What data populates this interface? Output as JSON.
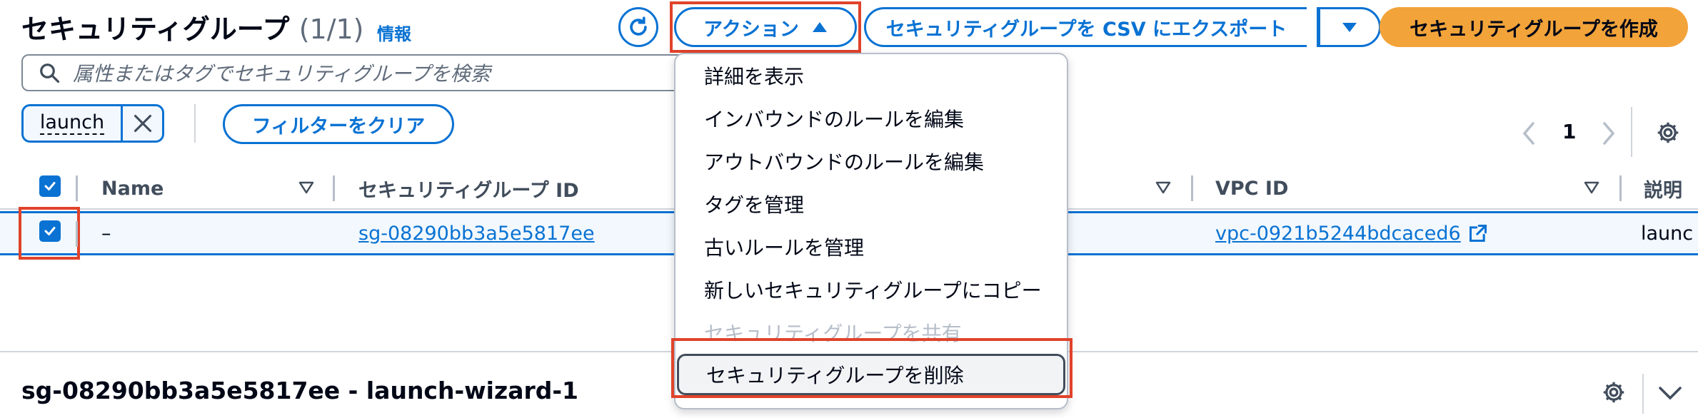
{
  "header": {
    "title": "セキュリティグループ",
    "count": "(1/1)",
    "info": "情報",
    "actions_label": "アクション",
    "export_label": "セキュリティグループを CSV にエクスポート",
    "create_label": "セキュリティグループを作成"
  },
  "search": {
    "placeholder": "属性またはタグでセキュリティグループを検索"
  },
  "filter": {
    "token": "launch",
    "clear_label": "フィルターをクリア"
  },
  "pagination": {
    "current_page": "1"
  },
  "table": {
    "columns": [
      "Name",
      "セキュリティグループ ID",
      "VPC ID",
      "説明"
    ],
    "rows": [
      {
        "name": "–",
        "sg_id": "sg-08290bb3a5e5817ee",
        "vpc_id": "vpc-0921b5244bdcaced6",
        "description": "launc"
      }
    ]
  },
  "actions_menu": {
    "items": [
      {
        "label": "詳細を表示",
        "disabled": false
      },
      {
        "label": "インバウンドのルールを編集",
        "disabled": false
      },
      {
        "label": "アウトバウンドのルールを編集",
        "disabled": false
      },
      {
        "label": "タグを管理",
        "disabled": false
      },
      {
        "label": "古いルールを管理",
        "disabled": false
      },
      {
        "label": "新しいセキュリティグループにコピー",
        "disabled": false
      },
      {
        "label": "セキュリティグループを共有",
        "disabled": true
      },
      {
        "label": "セキュリティグループを削除",
        "disabled": false
      }
    ]
  },
  "detail_panel": {
    "title": "sg-08290bb3a5e5817ee - launch-wizard-1"
  },
  "colors": {
    "link": "#0972d3",
    "primary_button": "#f2a33a",
    "highlight": "#e0432b"
  }
}
